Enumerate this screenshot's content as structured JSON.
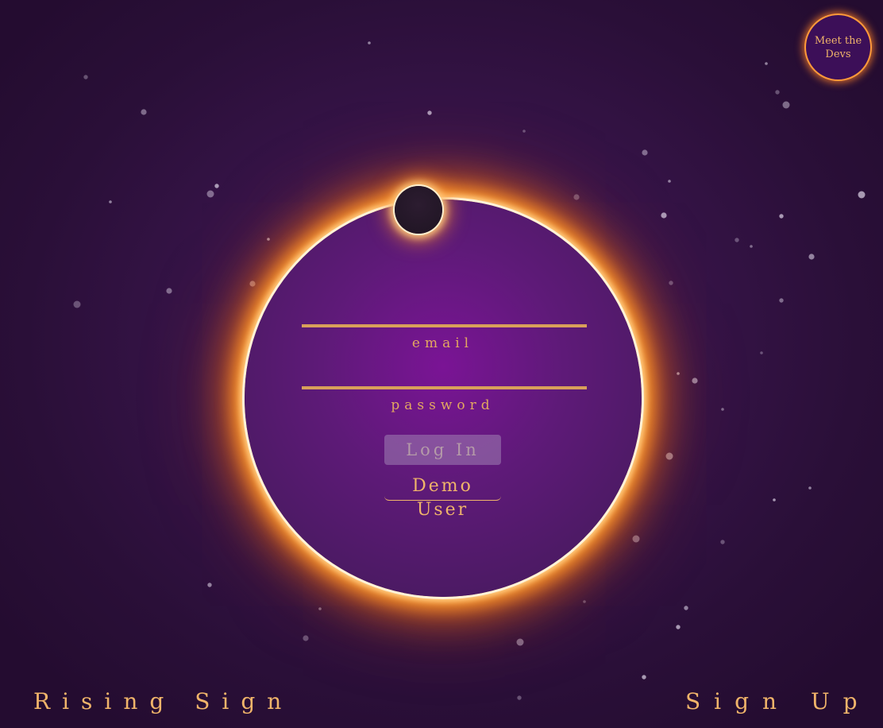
{
  "colors": {
    "accent": "#f0b46a",
    "background": "#2a0f38",
    "disc": "#5e1a78",
    "corona": "#ff9a2e"
  },
  "header": {
    "devs_button_label": "Meet the Devs"
  },
  "login_form": {
    "email_label": "email",
    "password_label": "password",
    "login_button_label": "Log In",
    "demo_button_label": "Demo User"
  },
  "footer": {
    "brand": "Rising Sign",
    "signup_label": "Sign Up"
  }
}
